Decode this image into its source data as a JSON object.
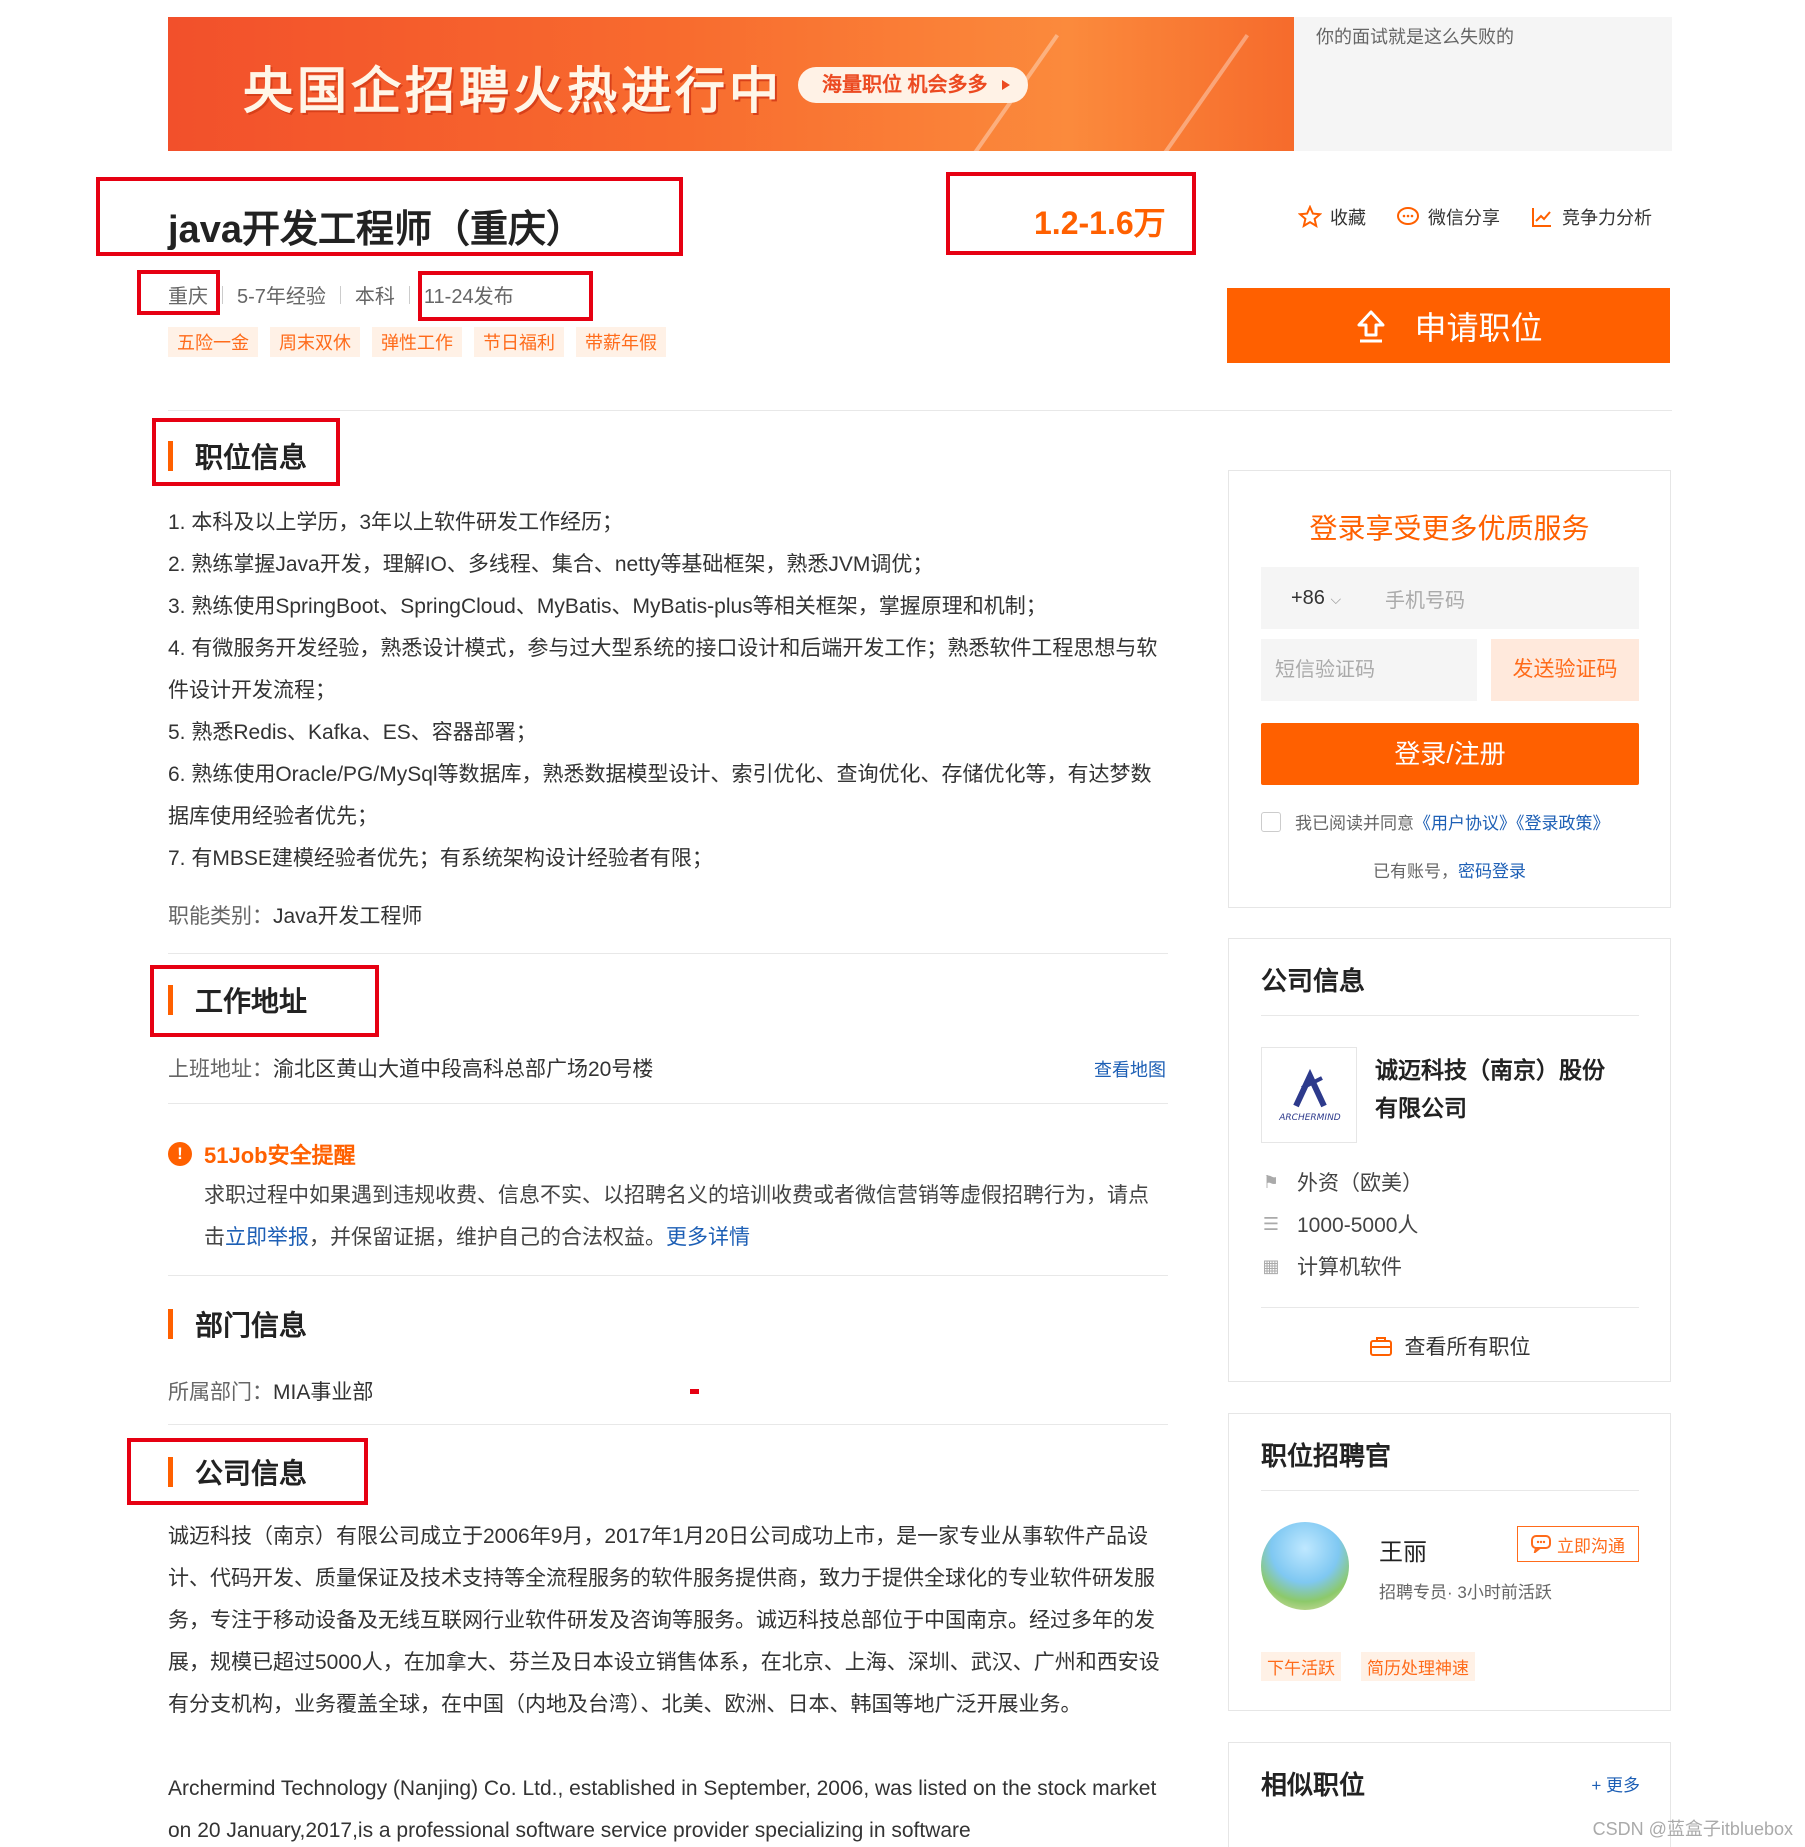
{
  "banner": {
    "title": "央国企招聘火热进行中",
    "pill": "海量职位 机会多多",
    "side_text": "你的面试就是这么失败的"
  },
  "job": {
    "title": "java开发工程师（重庆）",
    "salary": "1.2-1.6万",
    "city": "重庆",
    "experience": "5-7年经验",
    "education": "本科",
    "published": "11-24发布",
    "tags": [
      "五险一金",
      "周末双休",
      "弹性工作",
      "节日福利",
      "带薪年假"
    ]
  },
  "actions": {
    "favorite": "收藏",
    "wechat_share": "微信分享",
    "competitiveness": "竞争力分析"
  },
  "apply_button": "申请职位",
  "position_info": {
    "heading": "职位信息",
    "lines": [
      "1. 本科及以上学历，3年以上软件研发工作经历；",
      "2. 熟练掌握Java开发，理解IO、多线程、集合、netty等基础框架，熟悉JVM调优；",
      "3. 熟练使用SpringBoot、SpringCloud、MyBatis、MyBatis-plus等相关框架，掌握原理和机制；",
      "4. 有微服务开发经验，熟悉设计模式，参与过大型系统的接口设计和后端开发工作；熟悉软件工程思想与软件设计开发流程；",
      "5. 熟悉Redis、Kafka、ES、容器部署；",
      "6. 熟练使用Oracle/PG/MySql等数据库，熟悉数据模型设计、索引优化、查询优化、存储优化等，有达梦数据库使用经验者优先；",
      "7. 有MBSE建模经验者优先；有系统架构设计经验者有限；"
    ],
    "category_label": "职能类别：",
    "category_value": "Java开发工程师"
  },
  "work_address": {
    "heading": "工作地址",
    "label": "上班地址：",
    "value": "渝北区黄山大道中段高科总部广场20号楼",
    "map_link": "查看地图"
  },
  "safety": {
    "title": "51Job安全提醒",
    "text_a": "求职过程中如果遇到违规收费、信息不实、以招聘名义的培训收费或者微信营销等虚假招聘行为，请点击",
    "report_link": "立即举报",
    "text_b": "，并保留证据，维护自己的合法权益。",
    "more_link": "更多详情"
  },
  "department": {
    "heading": "部门信息",
    "label": "所属部门：",
    "value": "MIA事业部"
  },
  "company_section": {
    "heading": "公司信息",
    "intro_cn": "诚迈科技（南京）有限公司成立于2006年9月，2017年1月20日公司成功上市，是一家专业从事软件产品设计、代码开发、质量保证及技术支持等全流程服务的软件服务提供商，致力于提供全球化的专业软件研发服务，专注于移动设备及无线互联网行业软件研发及咨询等服务。诚迈科技总部位于中国南京。经过多年的发展，规模已超过5000人，在加拿大、芬兰及日本设立销售体系，在北京、上海、深圳、武汉、广州和西安设有分支机构，业务覆盖全球，在中国（内地及台湾）、北美、欧洲、日本、韩国等地广泛开展业务。",
    "intro_en": "Archermind Technology (Nanjing) Co. Ltd., established in September, 2006, was listed on the stock market on 20 January,2017,is a professional software service provider specializing in software"
  },
  "login": {
    "title": "登录享受更多优质服务",
    "country_code": "+86",
    "phone_placeholder": "手机号码",
    "sms_placeholder": "短信验证码",
    "send_code": "发送验证码",
    "login_button": "登录/注册",
    "agree_text": "我已阅读并同意",
    "user_agreement": "《用户协议》",
    "privacy_policy": "《登录政策》",
    "have_account": "已有账号，",
    "password_login": "密码登录"
  },
  "company_card": {
    "title": "公司信息",
    "logo_text": "ARCHERMIND",
    "name": "诚迈科技（南京）股份有限公司",
    "type": "外资（欧美）",
    "size": "1000-5000人",
    "industry": "计算机软件",
    "all_jobs": "查看所有职位"
  },
  "recruiter": {
    "title": "职位招聘官",
    "name": "王丽",
    "desc": "招聘专员· 3小时前活跃",
    "chat_button": "立即沟通",
    "tags": [
      "下午活跃",
      "简历处理神速"
    ]
  },
  "similar": {
    "title": "相似职位",
    "more": "+ 更多"
  },
  "watermark": "CSDN @蓝盒子itbluebox",
  "colors": {
    "accent": "#ff6000",
    "annotation_red": "#e60012",
    "link": "#1d5fb5"
  }
}
